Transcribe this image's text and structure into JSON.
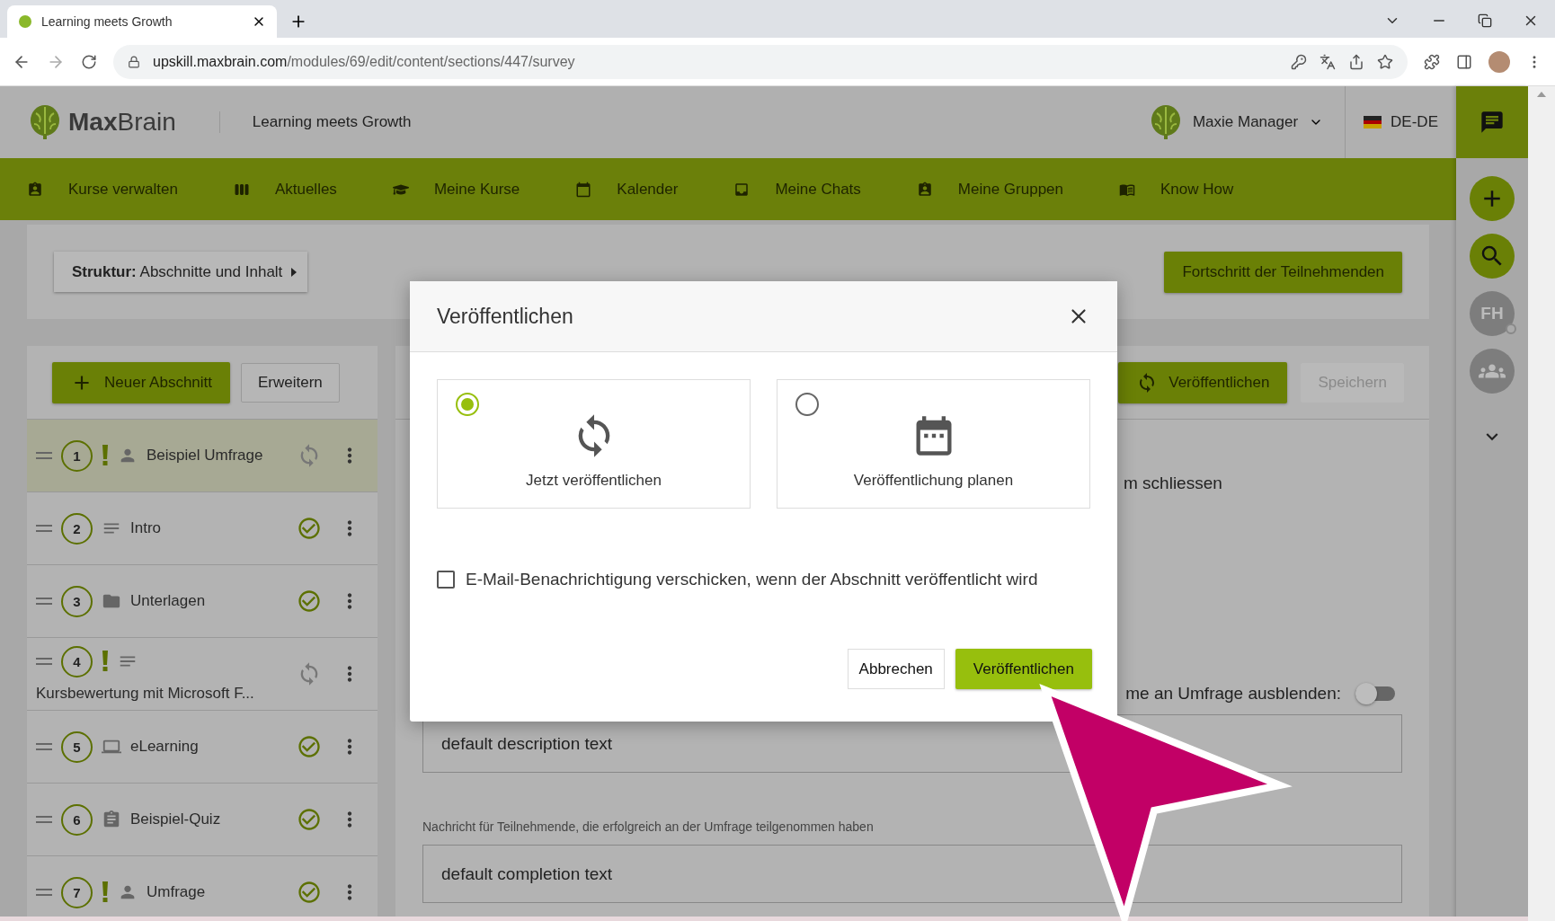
{
  "browser": {
    "tab_title": "Learning meets Growth",
    "url_host": "upskill.maxbrain.com",
    "url_path": "/modules/69/edit/content/sections/447/survey"
  },
  "header": {
    "logo": "**Max**Brain",
    "app_title": "Learning meets Growth",
    "user_name": "Maxie Manager",
    "language": "DE-DE"
  },
  "nav": [
    {
      "label": "Kurse verwalten",
      "kind": "card"
    },
    {
      "label": "Aktuelles",
      "kind": "columns"
    },
    {
      "label": "Meine Kurse",
      "kind": "cap"
    },
    {
      "label": "Kalender",
      "kind": "calendar"
    },
    {
      "label": "Meine Chats",
      "kind": "tray"
    },
    {
      "label": "Meine Gruppen",
      "kind": "card"
    },
    {
      "label": "Know How",
      "kind": "book"
    }
  ],
  "rail": [
    {
      "kind": "add"
    },
    {
      "kind": "search"
    },
    {
      "kind": "avatar",
      "initials": "FH"
    },
    {
      "kind": "group"
    },
    {
      "kind": "more"
    }
  ],
  "structure_button": "**Struktur:** Abschnitte und Inhalt",
  "progress_button": "Fortschritt der Teilnehmenden",
  "sections": {
    "new_button": "Neuer Abschnitt",
    "expand_button": "Erweitern",
    "items": [
      {
        "number": "1",
        "title": "Beispiel Umfrage",
        "kind": "survey",
        "warning": true,
        "published": false,
        "selected": true
      },
      {
        "number": "2",
        "title": "Intro",
        "kind": "text",
        "warning": false,
        "published": true,
        "selected": false
      },
      {
        "number": "3",
        "title": "Unterlagen",
        "kind": "folder",
        "warning": false,
        "published": true,
        "selected": false
      },
      {
        "number": "4",
        "title": "Kursbewertung mit Microsoft F...",
        "kind": "text",
        "warning": true,
        "published": false,
        "selected": false
      },
      {
        "number": "5",
        "title": "eLearning",
        "kind": "elearning",
        "warning": false,
        "published": true,
        "selected": false
      },
      {
        "number": "6",
        "title": "Beispiel-Quiz",
        "kind": "quiz",
        "warning": false,
        "published": true,
        "selected": false
      },
      {
        "number": "7",
        "title": "Umfrage",
        "kind": "survey",
        "warning": true,
        "published": true,
        "selected": false
      }
    ]
  },
  "editor": {
    "publish_button": "Veröffentlichen",
    "save_button": {
      "label": "Speichern",
      "disabled": true
    },
    "partial_text": "m schliessen",
    "toggle": {
      "label": "me an Umfrage ausblenden:",
      "on": false
    },
    "description_value": "default description text",
    "completion_label": "Nachricht für Teilnehmende, die erfolgreich an der Umfrage teilgenommen haben",
    "completion_value": "default completion text"
  },
  "modal": {
    "title": "Veröffentlichen",
    "options": [
      {
        "label": "Jetzt veröffentlichen",
        "kind": "now",
        "selected": true
      },
      {
        "label": "Veröffentlichung planen",
        "kind": "schedule",
        "selected": false
      }
    ],
    "email_checkbox": {
      "label": "E-Mail-Benachrichtigung verschicken, wenn der Abschnitt veröffentlicht wird",
      "checked": false
    },
    "cancel_button": "Abbrechen",
    "confirm_button": "Veröffentlichen"
  }
}
